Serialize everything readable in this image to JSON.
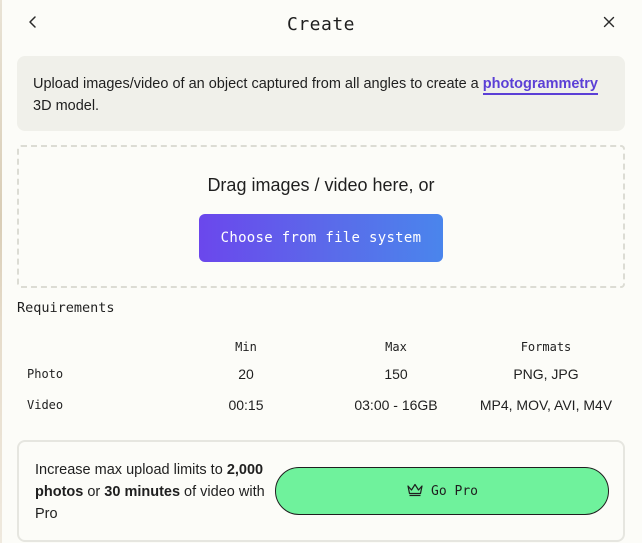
{
  "header": {
    "title": "Create",
    "back_icon": "chevron-left-icon",
    "close_icon": "close-icon"
  },
  "info": {
    "text_before": "Upload images/video of an object captured from all angles to create a ",
    "link": "photogrammetry",
    "text_after": " 3D model."
  },
  "dropzone": {
    "prompt": "Drag images / video here, or",
    "button_label": "Choose from file system"
  },
  "requirements": {
    "heading": "Requirements",
    "columns": [
      "",
      "Min",
      "Max",
      "Formats"
    ],
    "rows": [
      {
        "label": "Photo",
        "min": "20",
        "max": "150",
        "formats": "PNG, JPG"
      },
      {
        "label": "Video",
        "min": "00:15",
        "max": "03:00 - 16GB",
        "formats": "MP4, MOV, AVI, M4V"
      }
    ]
  },
  "pro": {
    "text_1": "Increase max upload limits to ",
    "bold_1": "2,000 photos",
    "text_2": " or ",
    "bold_2": "30 minutes",
    "text_3": " of video with Pro",
    "button_label": "Go Pro",
    "button_icon": "crown-icon"
  },
  "colors": {
    "accent": "#5b3fd6",
    "gradient_start": "#6b47ec",
    "gradient_end": "#4a85ec",
    "pro_green": "#6ff29c"
  }
}
